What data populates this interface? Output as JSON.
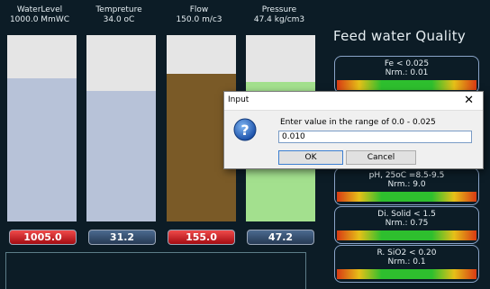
{
  "gauges": [
    {
      "name": "WaterLevel",
      "value_text": "1000.0 MmWC",
      "readout": "1005.0",
      "fill_fraction": 0.77,
      "fill_color": "#b7c2d8",
      "readout_color": "red"
    },
    {
      "name": "Tempreture",
      "value_text": "34.0 oC",
      "readout": "31.2",
      "fill_fraction": 0.7,
      "fill_color": "#b7c2d8",
      "readout_color": "blue"
    },
    {
      "name": "Flow",
      "value_text": "150.0 m/c3",
      "readout": "155.0",
      "fill_fraction": 0.79,
      "fill_color": "#7a5a27",
      "readout_color": "red"
    },
    {
      "name": "Pressure",
      "value_text": "47.4 kg/cm3",
      "readout": "47.2",
      "fill_fraction": 0.75,
      "fill_color": "#a3e08e",
      "readout_color": "blue"
    }
  ],
  "quality": {
    "title": "Feed water Quality",
    "items": [
      {
        "line1": "Fe < 0.025",
        "line2": "Nrm.: 0.01"
      },
      {
        "line1": "",
        "line2": ""
      },
      {
        "line1": "pH, 25oC =8.5-9.5",
        "line2": "Nrm.: 9.0"
      },
      {
        "line1": "Di. Solid < 1.5",
        "line2": "Nrm.: 0.75"
      },
      {
        "line1": "R. SiO2 < 0.20",
        "line2": "Nrm.: 0.1"
      }
    ]
  },
  "dialog": {
    "title": "Input",
    "close": "✕",
    "prompt": "Enter value in the range of 0.0 - 0.025",
    "input_value": "0.010",
    "ok_label": "OK",
    "cancel_label": "Cancel",
    "icon": "question-icon"
  },
  "colors": {
    "background": "#0c1c26",
    "readout_red": "#d02a2a",
    "readout_blue": "#344b6a"
  }
}
